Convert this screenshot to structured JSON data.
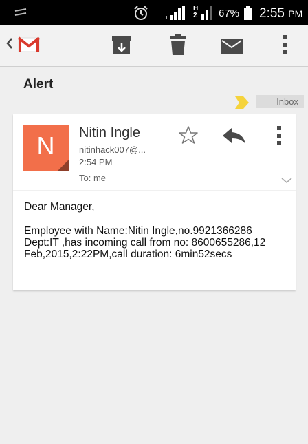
{
  "status_bar": {
    "battery_percent": "67%",
    "time": "2:55",
    "time_suffix": "PM",
    "icons": [
      "notification-icon",
      "alarm-icon",
      "signal-icon",
      "signal-h-icon",
      "battery-icon"
    ]
  },
  "action_bar": {
    "icons": [
      "back-icon",
      "gmail-logo-icon",
      "archive-icon",
      "delete-icon",
      "mark-unread-icon",
      "overflow-menu-icon"
    ]
  },
  "message": {
    "subject": "Alert",
    "label": "Inbox",
    "sender_initial": "N",
    "sender_name": "Nitin Ingle",
    "sender_email": "nitinhack007@...",
    "sent_time": "2:54 PM",
    "recipient": "To: me",
    "greeting": "Dear Manager,",
    "body": "Employee with Name:Nitin Ingle,no.9921366286 Dept:IT ,has incoming call from no: 8600655286,12 Feb,2015,2:22PM,call duration: 6min52secs"
  },
  "colors": {
    "avatar": "#f26f4a",
    "importance_marker": "#f5d33c",
    "background": "#efefef",
    "gmail_red": "#d93a2e"
  }
}
